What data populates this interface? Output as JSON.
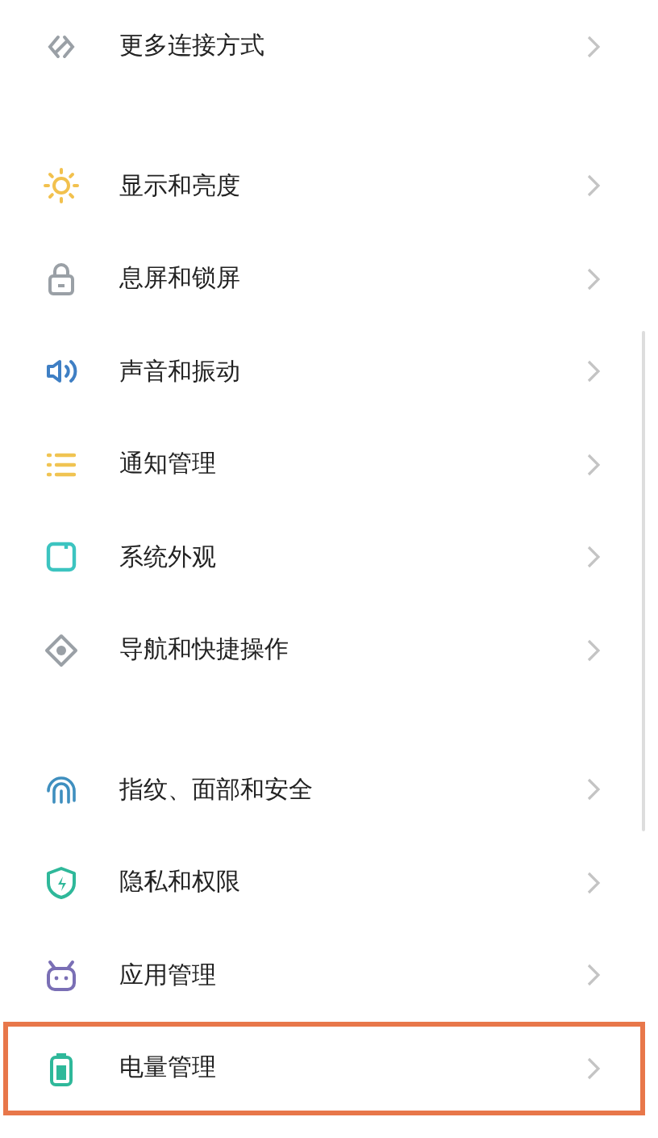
{
  "groups": [
    {
      "items": [
        {
          "label": "更多连接方式",
          "kind": "link",
          "highlighted": false
        }
      ]
    },
    {
      "items": [
        {
          "label": "显示和亮度",
          "kind": "sun",
          "highlighted": false
        },
        {
          "label": "息屏和锁屏",
          "kind": "lock",
          "highlighted": false
        },
        {
          "label": "声音和振动",
          "kind": "speaker",
          "highlighted": false
        },
        {
          "label": "通知管理",
          "kind": "list",
          "highlighted": false
        },
        {
          "label": "系统外观",
          "kind": "square",
          "highlighted": false
        },
        {
          "label": "导航和快捷操作",
          "kind": "target",
          "highlighted": false
        }
      ]
    },
    {
      "items": [
        {
          "label": "指纹、面部和安全",
          "kind": "fingerprint",
          "highlighted": false
        },
        {
          "label": "隐私和权限",
          "kind": "shield",
          "highlighted": false
        },
        {
          "label": "应用管理",
          "kind": "robot",
          "highlighted": false
        },
        {
          "label": "电量管理",
          "kind": "battery",
          "highlighted": true
        }
      ]
    }
  ]
}
